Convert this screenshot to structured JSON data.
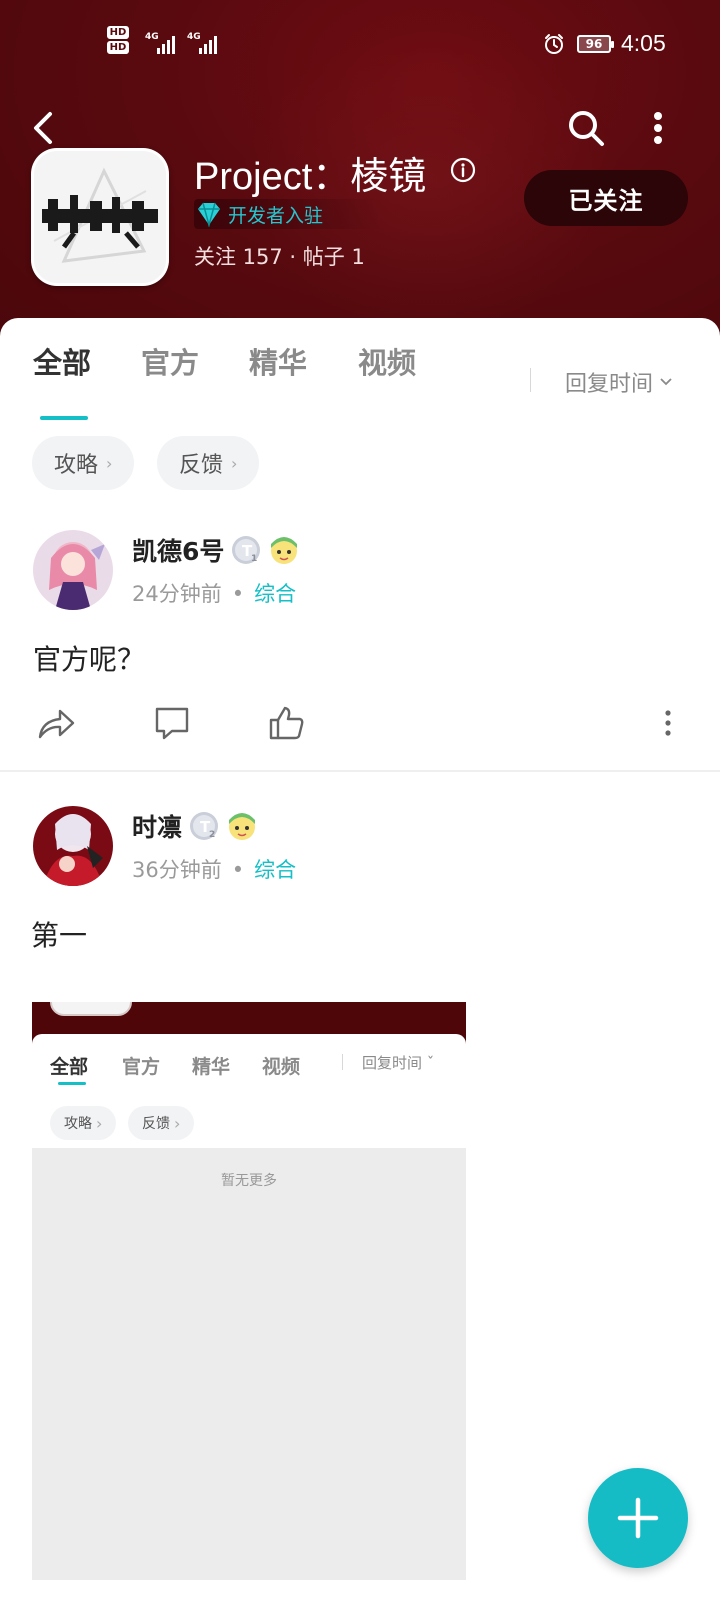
{
  "status_bar": {
    "hd1": "HD",
    "hd2": "HD",
    "net1": "4G",
    "net2": "4G",
    "battery": "96",
    "time": "4:05"
  },
  "header": {
    "app_name": "Project：棱镜",
    "badge_label": "开发者入驻",
    "stats": "关注 157 · 帖子 1",
    "follow_label": "已关注"
  },
  "colors": {
    "header_bg": "#590a0f",
    "accent": "#14bfc7",
    "follow_bg": "#2b0507"
  },
  "tabs": [
    {
      "label": "全部",
      "active": true
    },
    {
      "label": "官方",
      "active": false
    },
    {
      "label": "精华",
      "active": false
    },
    {
      "label": "视频",
      "active": false
    }
  ],
  "sort": {
    "label": "回复时间"
  },
  "chips": [
    {
      "label": "攻略"
    },
    {
      "label": "反馈"
    }
  ],
  "posts": [
    {
      "user": "凯德6号",
      "level": "1",
      "time": "24分钟前",
      "category": "综合",
      "text": "官方呢？"
    },
    {
      "user": "时凛",
      "level": "2",
      "time": "36分钟前",
      "category": "综合",
      "text": "第一"
    }
  ],
  "embedded_screenshot": {
    "tabs": [
      "全部",
      "官方",
      "精华",
      "视频"
    ],
    "sort": "回复时间",
    "chips": [
      "攻略",
      "反馈"
    ],
    "empty_text": "暂无更多"
  },
  "icons": {
    "back": "chevron-left-icon",
    "search": "search-icon",
    "more": "more-vertical-icon",
    "info": "info-icon",
    "share": "share-icon",
    "comment": "comment-icon",
    "like": "thumbs-up-icon",
    "fab": "plus-icon"
  }
}
